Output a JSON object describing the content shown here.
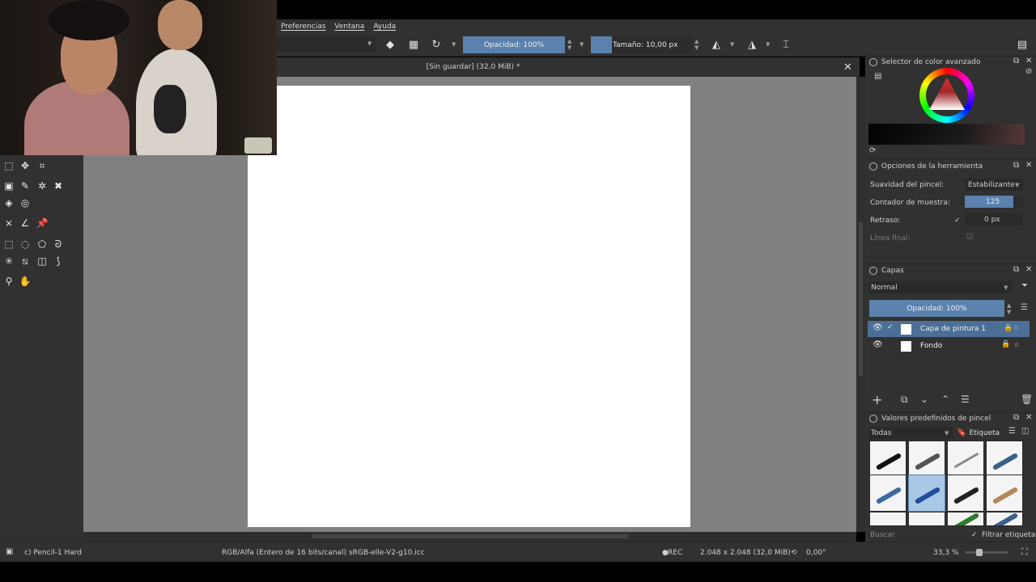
{
  "menu": [
    "Preferencias",
    "Ventana",
    "Ayuda"
  ],
  "toolbar": {
    "opacity_label": "Opacidad: 100%",
    "size_label": "Tamaño: 10,00 px"
  },
  "document": {
    "title": "[Sin guardar]  (32,0 MiB) *"
  },
  "color_selector": {
    "title": "Selector de color avanzado"
  },
  "tool_options": {
    "title": "Opciones de la herramienta",
    "rows": [
      {
        "label": "Suavidad del pincel:",
        "value": "Estabilizante"
      },
      {
        "label": "Contador de muestra:",
        "value": "125"
      },
      {
        "label": "Retraso:",
        "value": "0 px"
      },
      {
        "label": "Línea final:",
        "value": ""
      }
    ]
  },
  "layers": {
    "title": "Capas",
    "blend_mode": "Normal",
    "opacity_label": "Opacidad:  100%",
    "items": [
      {
        "name": "Capa de pintura 1",
        "active": true
      },
      {
        "name": "Fondo",
        "active": false
      }
    ]
  },
  "brush_presets": {
    "title": "Valores predefinidos de pincel",
    "filter_all": "Todas",
    "tag_label": "Etiqueta",
    "search_placeholder": "Buscar",
    "filter_tag_label": "Filtrar etiqueta"
  },
  "status": {
    "brush": "c) Pencil-1 Hard",
    "color_profile": "RGB/Alfa (Entero de 16 bits/canal)  sRGB-elle-V2-g10.icc",
    "rec": "REC",
    "dimensions": "2.048 x 2.048 (32,0 MiB)",
    "rotation": "0,00°",
    "zoom": "33,3 %"
  },
  "colors": {
    "panel": "#313131",
    "canvas_bg": "#808080",
    "accent": "#5a82ad",
    "layer_active": "#4b6f96"
  }
}
